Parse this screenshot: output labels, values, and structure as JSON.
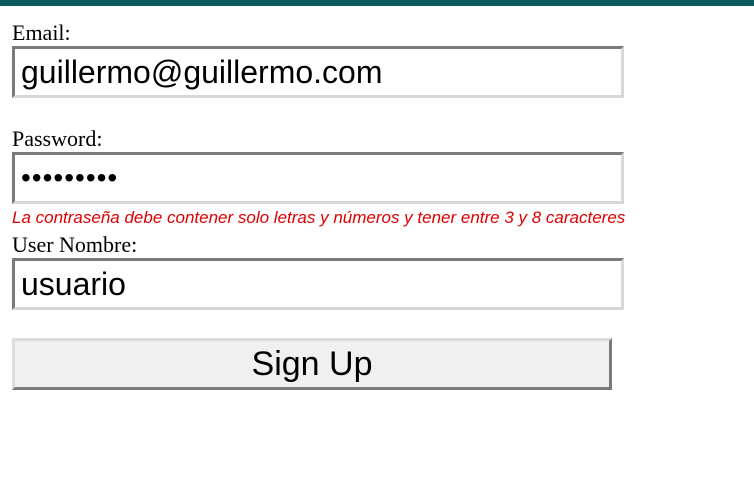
{
  "form": {
    "email": {
      "label": "Email:",
      "value": "guillermo@guillermo.com"
    },
    "password": {
      "label": "Password:",
      "masked_value": "•••••••••",
      "error": "La contraseña debe contener solo letras y números y tener entre 3 y 8 caracteres"
    },
    "username": {
      "label": "User Nombre:",
      "value": "usuario"
    },
    "submit_label": "Sign Up"
  },
  "colors": {
    "top_bar": "#0d5a5c",
    "error_text": "#e00000"
  }
}
